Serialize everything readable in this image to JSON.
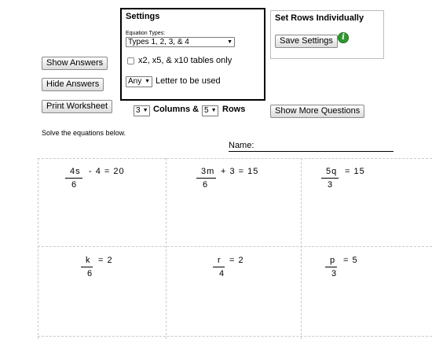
{
  "left_buttons": {
    "show_answers": "Show Answers",
    "hide_answers": "Hide Answers",
    "print_worksheet": "Print Worksheet"
  },
  "settings": {
    "title": "Settings",
    "equation_types_label": "Equation Types:",
    "equation_types_value": "Types 1, 2, 3, & 4",
    "tables_only_label": "x2, x5, & x10 tables only",
    "tables_only_checked": false,
    "letter_value": "Any",
    "letter_label": "Letter to be used"
  },
  "rows_panel": {
    "title": "Set Rows Individually",
    "save_label": "Save Settings",
    "info_icon": "info-icon",
    "info_color": "#2e9a2e"
  },
  "layout_controls": {
    "columns_value": "3",
    "columns_label": "Columns &",
    "rows_value": "5",
    "rows_label": "Rows",
    "show_more_label": "Show More Questions"
  },
  "instructions": "Solve the equations below.",
  "name_label": "Name:",
  "problems": [
    {
      "num": "4s",
      "den": "6",
      "rest": "-  4  =  20"
    },
    {
      "num": "3m",
      "den": "6",
      "rest": "+  3  =  15"
    },
    {
      "num": "5q",
      "den": "3",
      "rest": "=  15"
    },
    {
      "num": "k",
      "den": "6",
      "rest": "=  2"
    },
    {
      "num": "r",
      "den": "4",
      "rest": "=  2"
    },
    {
      "num": "p",
      "den": "3",
      "rest": "=  5"
    }
  ]
}
